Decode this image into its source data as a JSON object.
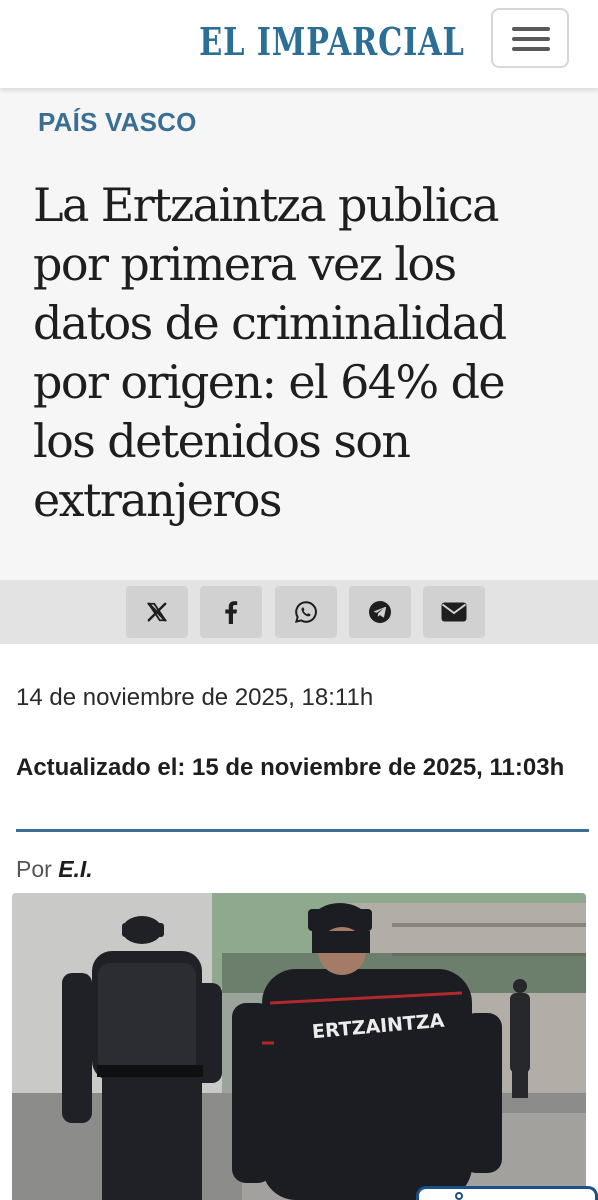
{
  "header": {
    "logo_text": "EL IMPARCIAL",
    "menu_icon": "hamburger-menu-icon"
  },
  "article": {
    "section": "PAÍS VASCO",
    "headline": "La Ertzaintza publica por primera vez los datos de criminalidad por origen: el 64% de los detenidos son extranjeros",
    "date": "14 de noviembre de 2025, 18:11h",
    "updated": "Actualizado el: 15 de noviembre de 2025, 11:03h",
    "byline_prefix": "Por",
    "author": "E.I.",
    "photo_text": "ERTZAINTZA"
  },
  "share": {
    "buttons": [
      {
        "name": "x",
        "icon": "x-logo-icon"
      },
      {
        "name": "facebook",
        "icon": "facebook-icon"
      },
      {
        "name": "whatsapp",
        "icon": "whatsapp-icon"
      },
      {
        "name": "telegram",
        "icon": "telegram-icon"
      },
      {
        "name": "email",
        "icon": "envelope-icon"
      }
    ]
  },
  "colors": {
    "brand": "#2b6f96",
    "section": "#3a6e92",
    "hero_bg": "#f6f6f6",
    "sharebar_bg": "#e3e3e3",
    "share_btn_bg": "#d1d1d1"
  }
}
